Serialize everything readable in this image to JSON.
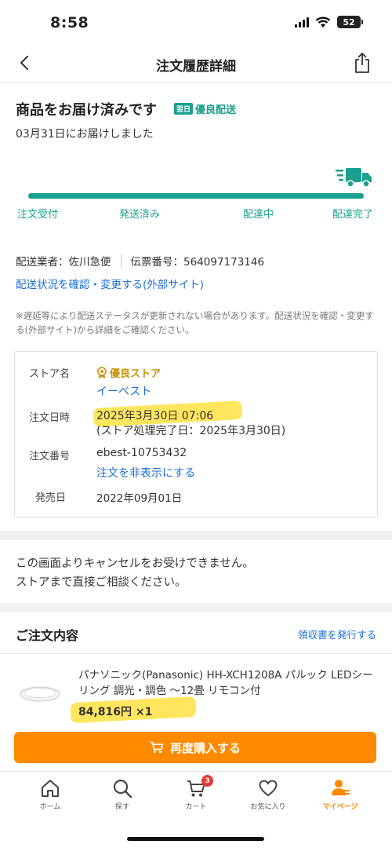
{
  "status_bar": {
    "time": "8:58",
    "battery": "52"
  },
  "nav": {
    "title": "注文履歴詳細"
  },
  "delivery": {
    "status_title": "商品をお届け済みです",
    "badge_box": "翌日",
    "badge_text": "優良配送",
    "delivered_date": "03月31日にお届けしました",
    "steps": [
      "注文受付",
      "発送済み",
      "配達中",
      "配達完了"
    ],
    "carrier": "配送業者：佐川急便",
    "tracking_number": "伝票番号：564097173146",
    "tracking_link": "配送状況を確認・変更する(外部サイト)",
    "notice": "※遅延等により配送ステータスが更新されない場合があります。配送状況を確認・変更する(外部サイト)から詳細をご確認ください。"
  },
  "store_card": {
    "store_label": "ストア名",
    "store_badge": "優良ストア",
    "store_name": "イーベスト",
    "order_date_label": "注文日時",
    "order_date": "2025年3月30日 07:06",
    "process_date": "(ストア処理完了日：2025年3月30日)",
    "order_number_label": "注文番号",
    "order_number": "ebest-10753432",
    "hide_link": "注文を非表示にする",
    "release_label": "発売日",
    "release_date": "2022年09月01日"
  },
  "cancel_notice": {
    "line1": "この画面よりキャンセルをお受けできません。",
    "line2": "ストアまで直接ご相談ください。"
  },
  "order_contents": {
    "title": "ご注文内容",
    "receipt_link": "領収書を発行する",
    "product_name": "パナソニック(Panasonic) HH-XCH1208A パルック LEDシーリング 調光・調色 〜12畳 リモコン付",
    "price": "84,816円 ×1",
    "rebuy_label": "再度購入する"
  },
  "tab_bar": {
    "home": "ホーム",
    "search": "探す",
    "cart": "カート",
    "cart_count": "3",
    "favorites": "お気に入り",
    "mypage": "マイページ"
  },
  "colors": {
    "accent_teal": "#1aa08e",
    "link_blue": "#1a6ed8",
    "orange": "#ff8a00",
    "highlight_yellow": "#ffdd28",
    "badge_red": "#e53935"
  },
  "icons": [
    "back-chevron-icon",
    "share-icon",
    "delivery-truck-icon",
    "cart-icon",
    "home-icon",
    "search-icon",
    "heart-icon",
    "person-icon"
  ]
}
